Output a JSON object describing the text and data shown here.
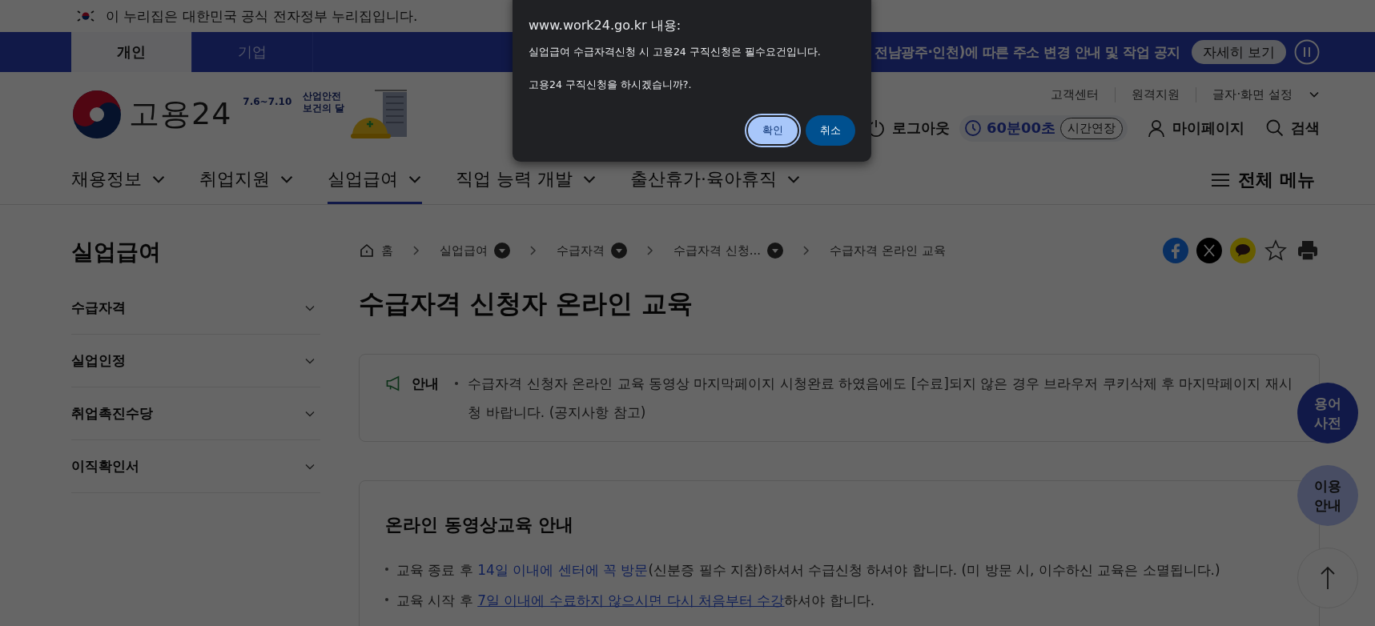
{
  "gov_banner": {
    "text": "이 누리집은 대한민국 공식 전자정부 누리집입니다."
  },
  "top_bar": {
    "tabs": [
      {
        "label": "개인",
        "selected": true
      },
      {
        "label": "기업",
        "selected": false
      }
    ],
    "notice": "전남광주·인천)에 따른 주소 변경 안내 및 작업 공지",
    "more_button": "자세히 보기"
  },
  "header": {
    "logo": {
      "text": "고용24",
      "event_dates": "7.6~7.10",
      "event_lines": [
        "산업안전",
        "보건의 달"
      ]
    },
    "utility_links": [
      "고객센터",
      "원격지원",
      "글자·화면 설정"
    ],
    "logout": "로그아웃",
    "timer": "60분00초",
    "extend_button": "시간연장",
    "mypage": "마이페이지",
    "search": "검색"
  },
  "nav": {
    "items": [
      {
        "label": "채용정보",
        "selected": false
      },
      {
        "label": "취업지원",
        "selected": false
      },
      {
        "label": "실업급여",
        "selected": true
      },
      {
        "label": "직업 능력 개발",
        "selected": false
      },
      {
        "label": "출산휴가·육아휴직",
        "selected": false
      }
    ],
    "all_menu": "전체 메뉴"
  },
  "sidebar": {
    "title": "실업급여",
    "items": [
      "수급자격",
      "실업인정",
      "취업촉진수당",
      "이직확인서"
    ]
  },
  "breadcrumb": [
    {
      "label": "홈",
      "kind": "home"
    },
    {
      "label": "실업급여",
      "kind": "dropdown"
    },
    {
      "label": "수급자격",
      "kind": "dropdown"
    },
    {
      "label": "수급자격 신청...",
      "kind": "dropdown"
    },
    {
      "label": "수급자격 온라인 교육",
      "kind": "current"
    }
  ],
  "page_title": "수급자격 신청자 온라인 교육",
  "notice": {
    "label": "안내",
    "text": "수급자격 신청자 온라인 교육 동영상 마지막페이지 시청완료 하였음에도 [수료]되지 않은 경우 브라우저 쿠키삭제 후 마지막페이지 재시청 바랍니다. (공지사항 참고)"
  },
  "guide": {
    "heading": "온라인 동영상교육 안내",
    "items": [
      [
        {
          "text": "교육 종료 후 ",
          "kind": "plain"
        },
        {
          "text": "14일 이내에 센터에 꼭 방문",
          "kind": "link"
        },
        {
          "text": "(신분증 필수 지참)하셔서 수급신청 하셔야 합니다. (미 방문 시, 이수하신 교육은 소멸됩니다.)",
          "kind": "plain"
        }
      ],
      [
        {
          "text": "교육 시작 후 ",
          "kind": "plain"
        },
        {
          "text": "7일 이내에 수료하지 않으시면 다시 처음부터 수강",
          "kind": "underlined-link"
        },
        {
          "text": "하셔야 합니다.",
          "kind": "plain"
        }
      ]
    ]
  },
  "floating": [
    {
      "label": "용어 사전",
      "kind": "dark"
    },
    {
      "label": "이용 안내",
      "kind": "light"
    },
    {
      "kind": "top"
    }
  ],
  "dialog": {
    "title": "www.work24.go.kr 내용:",
    "lines": [
      "실업급여 수급자격신청 시 고용24 구직신청은 필수요건입니다.",
      "고용24 구직신청을 하시겠습니까?."
    ],
    "buttons": [
      {
        "label": "확인",
        "kind": "primary"
      },
      {
        "label": "취소",
        "kind": "secondary"
      }
    ]
  }
}
